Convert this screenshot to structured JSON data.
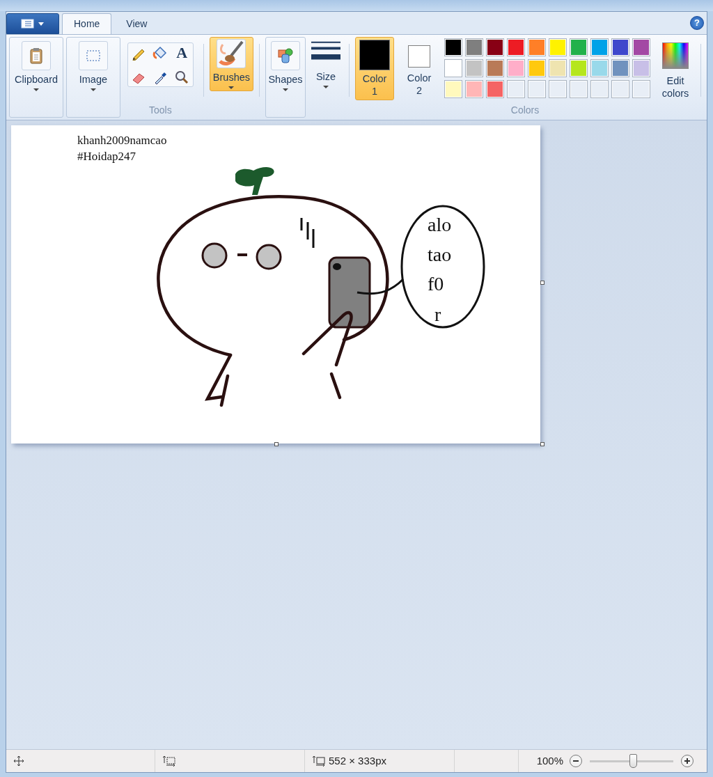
{
  "tabs": [
    {
      "label": "Home",
      "selected": true
    },
    {
      "label": "View",
      "selected": false
    }
  ],
  "help": {
    "glyph": "?"
  },
  "ribbon": {
    "clipboard": {
      "label": "Clipboard"
    },
    "image": {
      "label": "Image"
    },
    "tools": {
      "label": "Tools",
      "text_glyph": "A"
    },
    "brushes": {
      "label": "Brushes",
      "selected": true
    },
    "shapes": {
      "label": "Shapes"
    },
    "size": {
      "label": "Size"
    },
    "colors": {
      "label": "Colors",
      "color_slots": [
        {
          "label": "Color 1",
          "color": "#000000",
          "selected": true
        },
        {
          "label": "Color 2",
          "color": "#ffffff",
          "selected": false
        }
      ],
      "palette": [
        {
          "kind": "swatch",
          "color": "#000000"
        },
        {
          "kind": "swatch",
          "color": "#7f7f7f"
        },
        {
          "kind": "swatch",
          "color": "#880015"
        },
        {
          "kind": "swatch",
          "color": "#ed1c24"
        },
        {
          "kind": "swatch",
          "color": "#ff7f27"
        },
        {
          "kind": "swatch",
          "color": "#fff200"
        },
        {
          "kind": "swatch",
          "color": "#22b14c"
        },
        {
          "kind": "swatch",
          "color": "#00a2e8"
        },
        {
          "kind": "swatch",
          "color": "#3f48cc"
        },
        {
          "kind": "swatch",
          "color": "#a349a4"
        },
        {
          "kind": "swatch",
          "color": "#ffffff"
        },
        {
          "kind": "swatch",
          "color": "#c3c3c3"
        },
        {
          "kind": "swatch",
          "color": "#b97a57"
        },
        {
          "kind": "swatch",
          "color": "#ffaec9"
        },
        {
          "kind": "swatch",
          "color": "#ffc90e"
        },
        {
          "kind": "swatch",
          "color": "#efe4b0"
        },
        {
          "kind": "swatch",
          "color": "#b5e61d"
        },
        {
          "kind": "swatch",
          "color": "#99d9ea"
        },
        {
          "kind": "swatch",
          "color": "#7092be"
        },
        {
          "kind": "swatch",
          "color": "#c8bfe7"
        },
        {
          "kind": "swatch",
          "color": "#fff9bd"
        },
        {
          "kind": "swatch",
          "color": "#ffb6b6"
        },
        {
          "kind": "swatch",
          "color": "#f56464"
        },
        {
          "kind": "empty"
        },
        {
          "kind": "empty"
        },
        {
          "kind": "empty"
        },
        {
          "kind": "empty"
        },
        {
          "kind": "empty"
        },
        {
          "kind": "empty"
        },
        {
          "kind": "empty"
        }
      ],
      "edit_colors": {
        "label": "Edit colors"
      }
    }
  },
  "canvas": {
    "texts": [
      "khanh2009namcao",
      "#Hoidap247"
    ],
    "bubble_lines": [
      "alo",
      "tao",
      "f0",
      "r"
    ]
  },
  "status_bar": {
    "dimensions": "552 × 333px",
    "zoom": "100%",
    "zoom_slider": {
      "level": 0.52
    }
  }
}
